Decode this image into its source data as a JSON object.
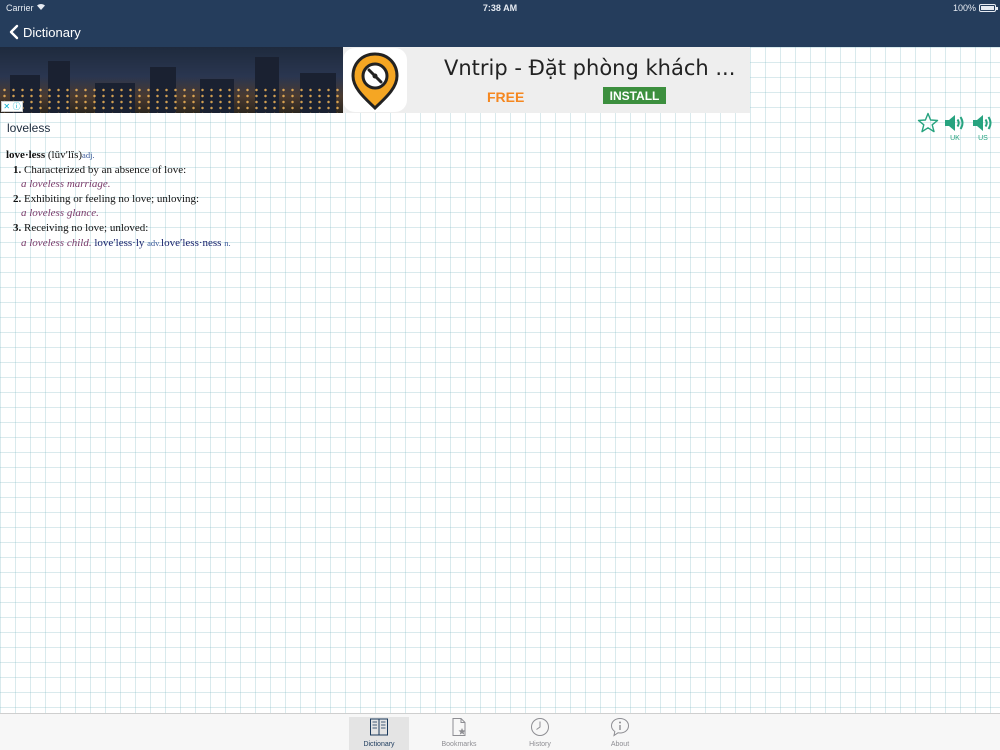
{
  "status_bar": {
    "carrier": "Carrier",
    "time": "7:38 AM",
    "battery": "100%"
  },
  "nav": {
    "back_label": "Dictionary"
  },
  "ad": {
    "title": "Vntrip - Đặt phòng khách ...",
    "free_label": "FREE",
    "install_label": "INSTALL",
    "close_symbol": "✕",
    "info_symbol": "ⓘ",
    "accent_color": "#f5871f",
    "install_color": "#3c8f3e"
  },
  "word_heading": "loveless",
  "actions": {
    "bookmark_icon": "star-outline",
    "uk_label": "UK",
    "us_label": "US",
    "accent_color": "#27a37f"
  },
  "entry": {
    "headword": "love·less",
    "pronunciation": "(lŭv′lĭs)",
    "part_of_speech": "adj.",
    "senses": [
      {
        "number": "1.",
        "definition": "Characterized by an absence of love:",
        "example": "a loveless marriage."
      },
      {
        "number": "2.",
        "definition": "Exhibiting or feeling no love; unloving:",
        "example": "a loveless glance."
      },
      {
        "number": "3.",
        "definition": "Receiving no love; unloved:",
        "example": "a loveless child."
      }
    ],
    "derived": [
      {
        "word": "love′less·ly",
        "pos": "adv."
      },
      {
        "word": "love′less·ness",
        "pos": "n."
      }
    ]
  },
  "tabs": [
    {
      "label": "Dictionary",
      "icon": "book-icon",
      "active": true
    },
    {
      "label": "Bookmarks",
      "icon": "bookmark-page-icon",
      "active": false
    },
    {
      "label": "History",
      "icon": "clock-icon",
      "active": false
    },
    {
      "label": "About",
      "icon": "info-bubble-icon",
      "active": false
    }
  ]
}
